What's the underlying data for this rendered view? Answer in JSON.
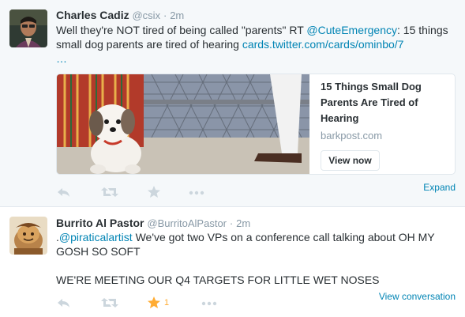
{
  "tweets": [
    {
      "fullname": "Charles Cadiz",
      "username": "@csix",
      "sep": "·",
      "time": "2m",
      "text_parts": {
        "p1": "Well they're NOT tired of being called \"parents\" RT ",
        "mention": "@CuteEmergency",
        "p2": ": 15 things small dog parents are tired of hearing ",
        "url": "cards.twitter.com/cards/ominbo/7",
        "url_cont": "…"
      },
      "card": {
        "title": "15 Things Small Dog Parents Are Tired of Hearing",
        "domain": "barkpost.com",
        "button": "View now"
      },
      "actions": {
        "reply_icon": "reply-icon",
        "retweet_icon": "retweet-icon",
        "favorite_icon": "star-icon",
        "more_icon": "more-icon"
      },
      "right_link": "Expand"
    },
    {
      "fullname": "Burrito Al Pastor",
      "username": "@BurritoAlPastor",
      "sep": "·",
      "time": "2m",
      "text_parts": {
        "p1": ".",
        "mention": "@piraticalartist",
        "p2": " We've got two VPs on a conference call talking about OH MY GOSH SO SOFT",
        "p3": "WE'RE MEETING OUR Q4 TARGETS FOR LITTLE WET NOSES"
      },
      "actions": {
        "favorite_count": "1"
      },
      "right_link": "View conversation"
    }
  ],
  "colors": {
    "link": "#0084b4",
    "muted": "#8899a6",
    "favorited": "#ffac33",
    "card_bg": "#f5f8fa"
  }
}
